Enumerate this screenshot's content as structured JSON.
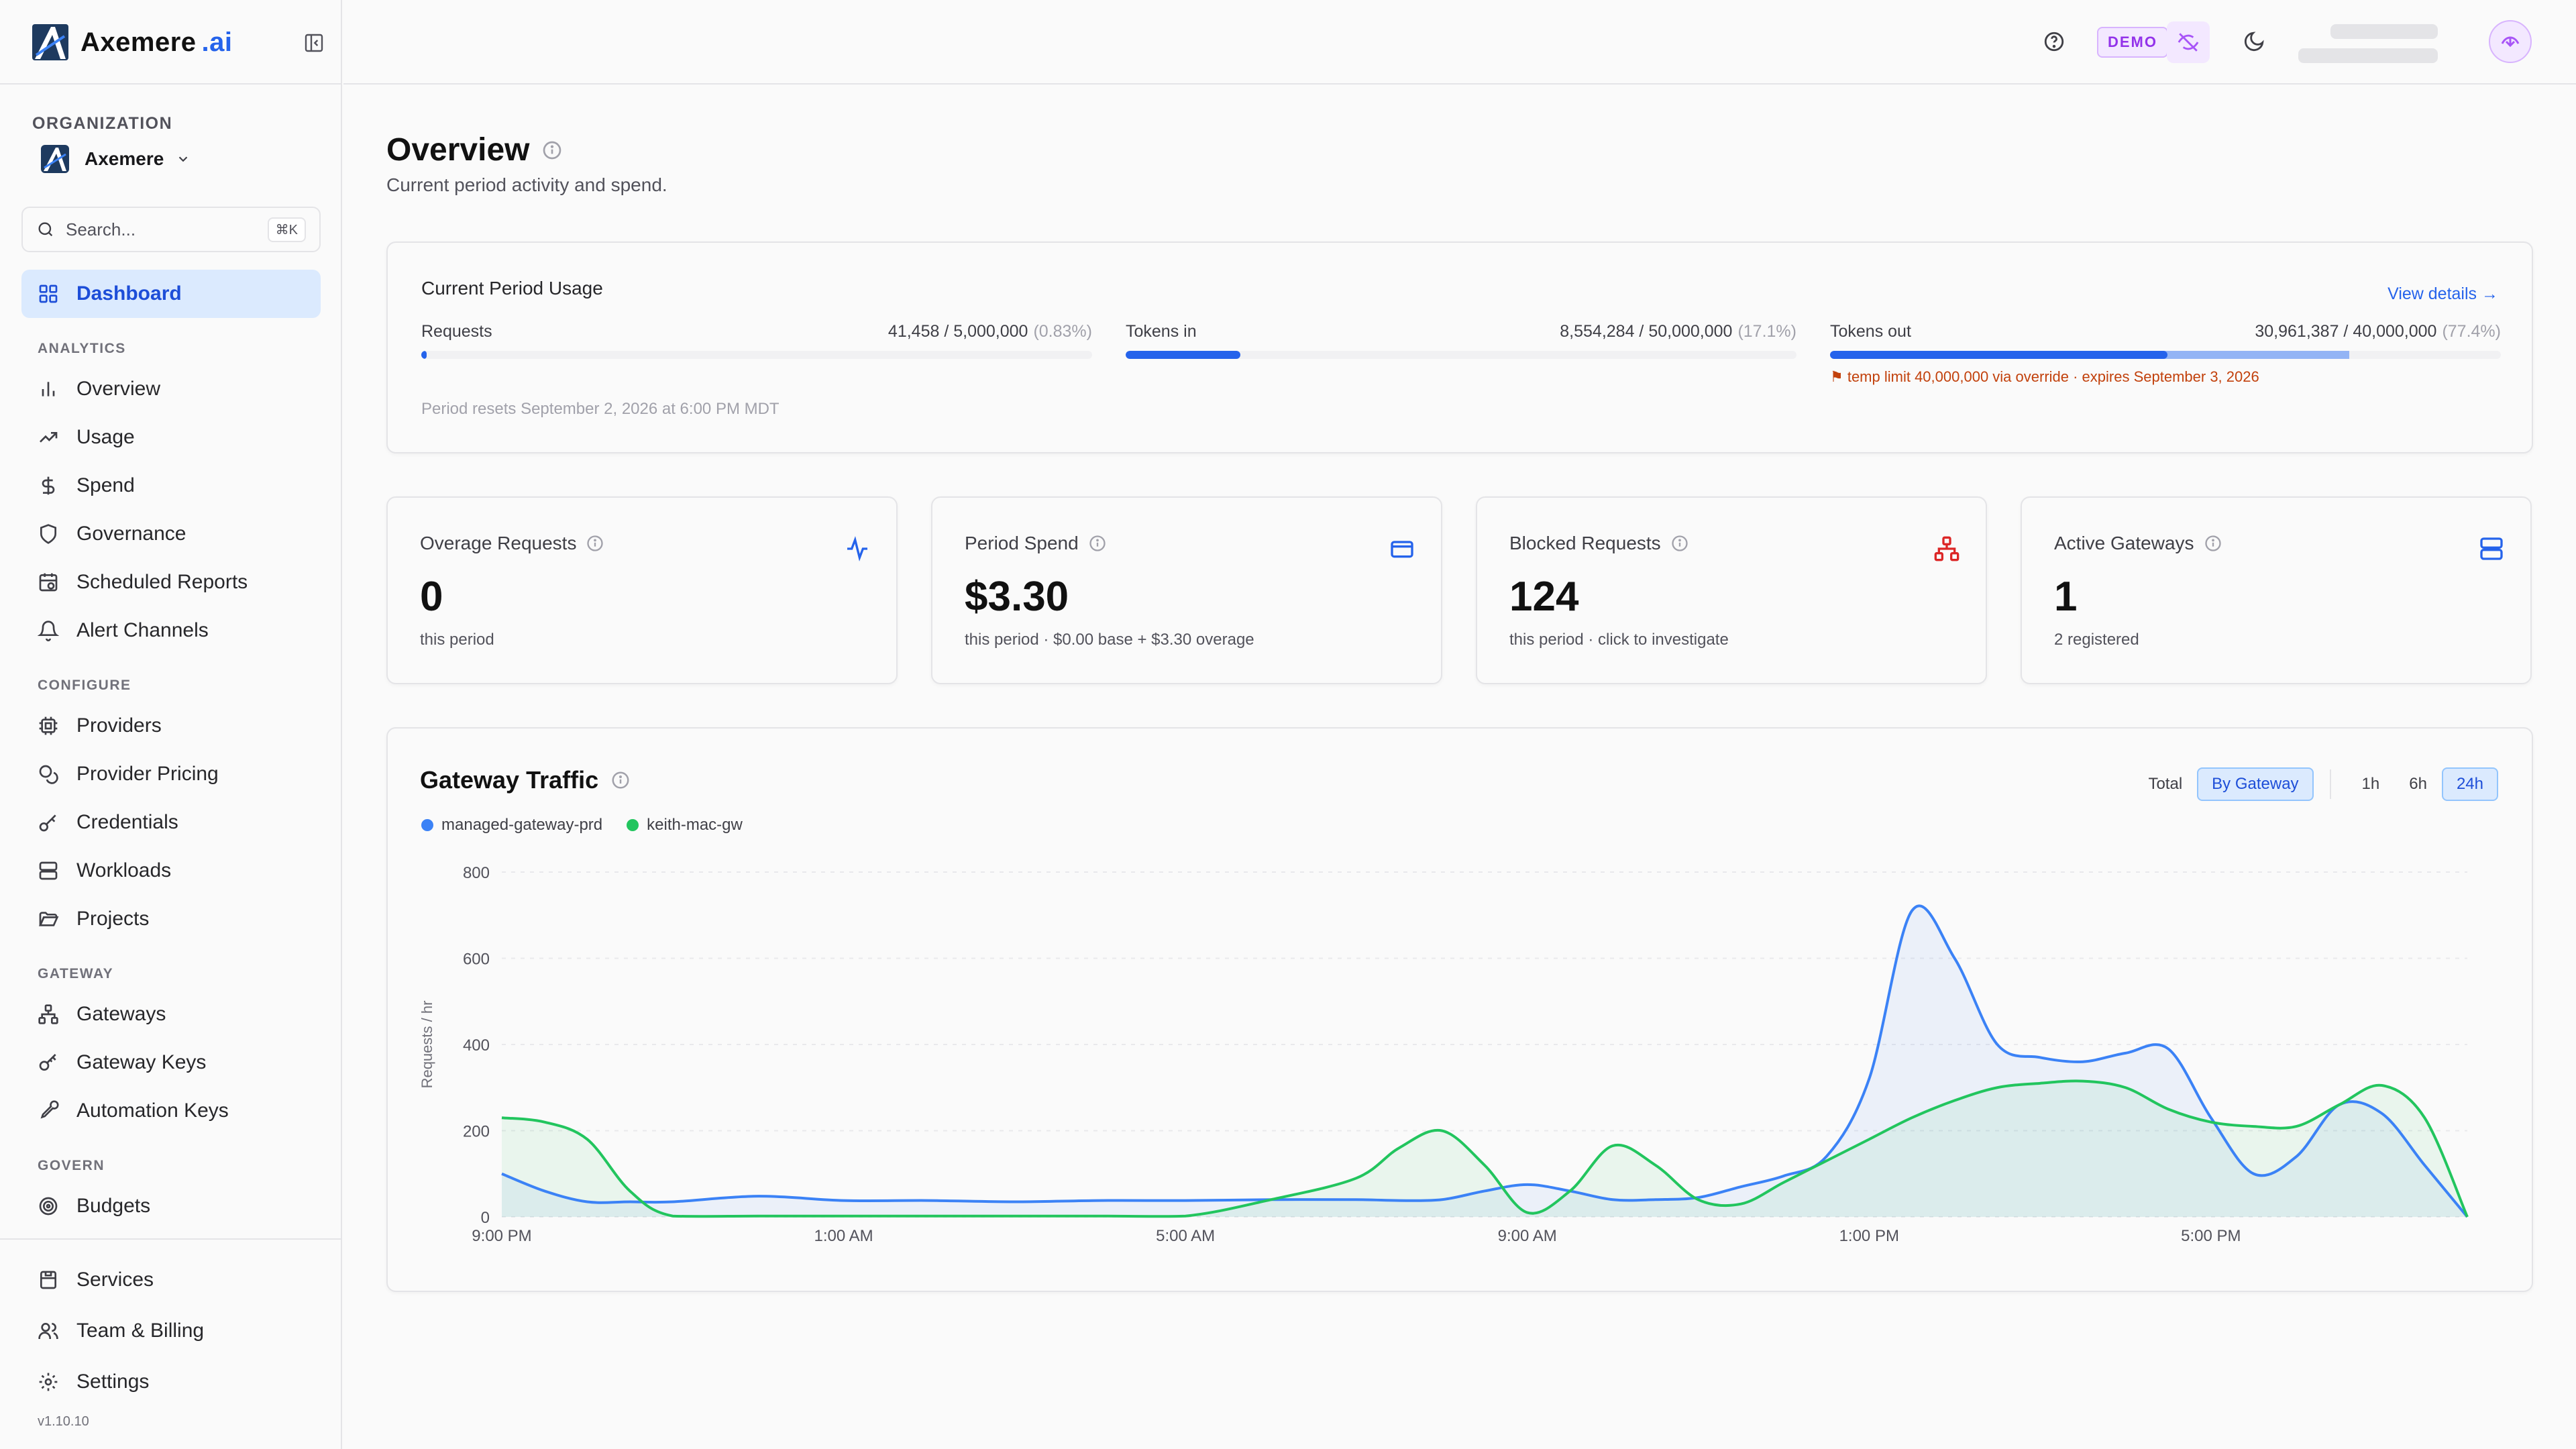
{
  "brand": {
    "name": "Axemere",
    "suffix": ".ai"
  },
  "organization": {
    "label": "ORGANIZATION",
    "name": "Axemere"
  },
  "search": {
    "placeholder": "Search...",
    "shortcut": "⌘K"
  },
  "nav": {
    "dashboard": "Dashboard",
    "sections": {
      "analytics": "ANALYTICS",
      "configure": "CONFIGURE",
      "gateway": "GATEWAY",
      "govern": "GOVERN"
    },
    "analytics": [
      "Overview",
      "Usage",
      "Spend",
      "Governance",
      "Scheduled Reports",
      "Alert Channels"
    ],
    "configure": [
      "Providers",
      "Provider Pricing",
      "Credentials",
      "Workloads",
      "Projects"
    ],
    "gateway": [
      "Gateways",
      "Gateway Keys",
      "Automation Keys"
    ],
    "govern": [
      "Budgets"
    ],
    "footer": [
      "Services",
      "Team & Billing",
      "Settings"
    ],
    "version": "v1.10.10"
  },
  "header": {
    "demo_badge": "DEMO"
  },
  "page": {
    "title": "Overview",
    "subtitle": "Current period activity and spend."
  },
  "usage": {
    "title": "Current Period Usage",
    "view_details": "View details →",
    "requests": {
      "label": "Requests",
      "value": "41,458 / 5,000,000",
      "pct": "(0.83%)",
      "fill": 0.0083
    },
    "tokens_in": {
      "label": "Tokens in",
      "value": "8,554,284 / 50,000,000",
      "pct": "(17.1%)",
      "fill": 0.171
    },
    "tokens_out": {
      "label": "Tokens out",
      "value": "30,961,387 / 40,000,000",
      "pct": "(77.4%)",
      "fill_base": 0.503,
      "fill": 0.774
    },
    "override_note": "⚑ temp limit 40,000,000 via override · expires September 3, 2026",
    "reset_note": "Period resets September 2, 2026 at 6:00 PM MDT"
  },
  "stats": [
    {
      "title": "Overage Requests",
      "value": "0",
      "sub": "this period",
      "icon": "activity-icon",
      "color": "#2563eb"
    },
    {
      "title": "Period Spend",
      "value": "$3.30",
      "sub": "this period · $0.00 base + $3.30 overage",
      "icon": "credit-card-icon",
      "color": "#2563eb"
    },
    {
      "title": "Blocked Requests",
      "value": "124",
      "sub": "this period · click to investigate",
      "icon": "network-icon",
      "color": "#dc2626"
    },
    {
      "title": "Active Gateways",
      "value": "1",
      "sub": "2 registered",
      "icon": "server-icon",
      "color": "#2563eb"
    }
  ],
  "traffic": {
    "title": "Gateway Traffic",
    "toggle": [
      "Total",
      "By Gateway"
    ],
    "ranges": [
      "1h",
      "6h",
      "24h"
    ],
    "selected_toggle": "By Gateway",
    "selected_range": "24h"
  },
  "chart_data": {
    "type": "area",
    "ylabel": "Requests / hr",
    "ylim": [
      0,
      800
    ],
    "yticks": [
      0,
      200,
      400,
      600,
      800
    ],
    "xticks": [
      "9:00 PM",
      "1:00 AM",
      "5:00 AM",
      "9:00 AM",
      "1:00 PM",
      "5:00 PM"
    ],
    "x": [
      0,
      0.5,
      1,
      1.5,
      2,
      3,
      4,
      5,
      6,
      7,
      8,
      9,
      10,
      10.5,
      11,
      11.5,
      12,
      12.5,
      13,
      13.5,
      14,
      14.5,
      15,
      15.5,
      16,
      16.5,
      17,
      17.5,
      18,
      18.5,
      19,
      19.5,
      20,
      20.5,
      21,
      21.5,
      22,
      22.5,
      23
    ],
    "grid": true,
    "series": [
      {
        "name": "managed-gateway-prd",
        "color": "#3b82f6",
        "values": [
          100,
          60,
          35,
          35,
          35,
          48,
          38,
          38,
          35,
          38,
          38,
          40,
          40,
          38,
          40,
          60,
          75,
          60,
          40,
          40,
          45,
          70,
          95,
          140,
          320,
          710,
          600,
          400,
          370,
          360,
          380,
          390,
          230,
          100,
          140,
          260,
          240,
          120,
          0
        ]
      },
      {
        "name": "keith-mac-gw",
        "color": "#22c55e",
        "values": [
          230,
          220,
          180,
          60,
          2,
          2,
          2,
          2,
          2,
          2,
          2,
          40,
          90,
          160,
          200,
          120,
          10,
          60,
          165,
          120,
          40,
          30,
          80,
          130,
          180,
          230,
          270,
          300,
          310,
          315,
          300,
          250,
          220,
          210,
          210,
          260,
          305,
          230,
          0
        ]
      }
    ]
  }
}
